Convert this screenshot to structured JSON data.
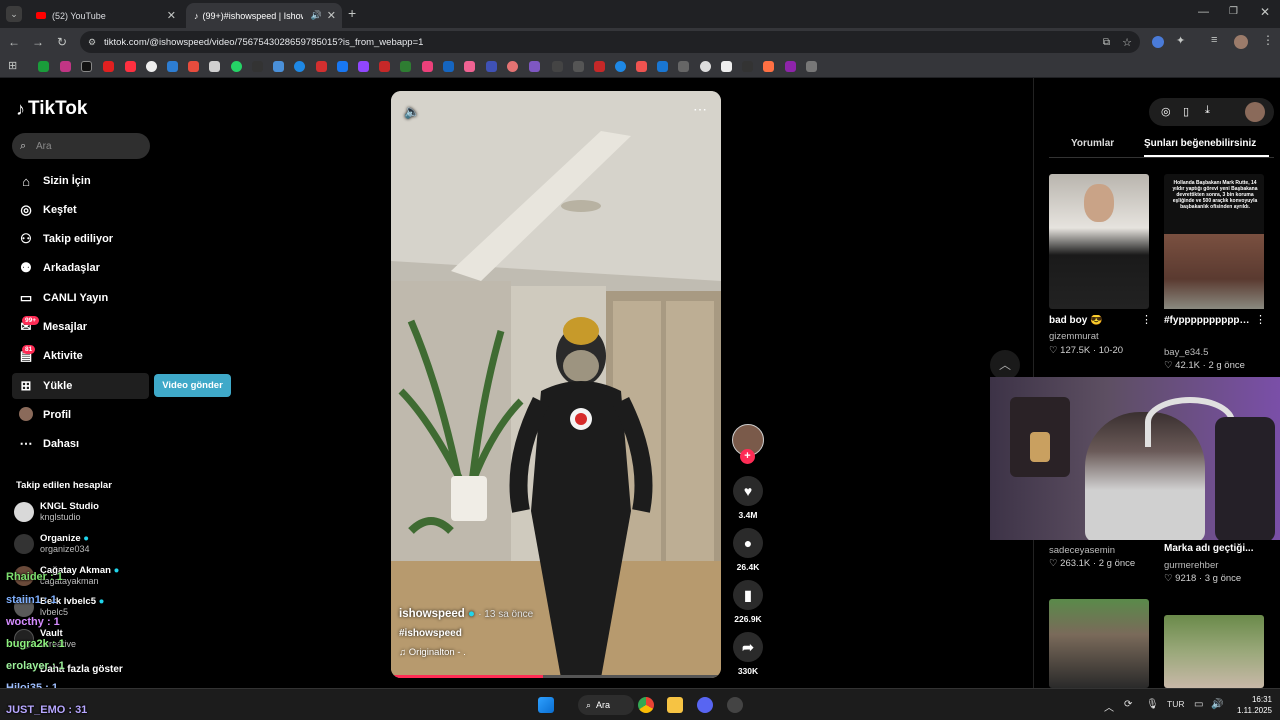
{
  "browser": {
    "tabs": [
      {
        "label": "(52) YouTube"
      },
      {
        "label": "(99+)#ishowspeed | Ishows"
      }
    ],
    "url": "tiktok.com/@ishowspeed/video/7567543028659785015?is_from_webapp=1"
  },
  "sidebar": {
    "logo": "TikTok",
    "search_placeholder": "Ara",
    "items": [
      {
        "label": "Sizin İçin"
      },
      {
        "label": "Keşfet"
      },
      {
        "label": "Takip ediliyor"
      },
      {
        "label": "Arkadaşlar"
      },
      {
        "label": "CANLI Yayın"
      },
      {
        "label": "Mesajlar",
        "badge": "99+"
      },
      {
        "label": "Aktivite",
        "badge": "81"
      },
      {
        "label": "Yükle"
      },
      {
        "label": "Profil"
      },
      {
        "label": "Dahası"
      }
    ],
    "upload_button": "Video gönder",
    "following_header": "Takip edilen hesaplar",
    "following": [
      {
        "name": "KNGL Studio",
        "user": "knglstudio"
      },
      {
        "name": "Organize",
        "user": "organize034"
      },
      {
        "name": "Çağatay Akman",
        "user": "cagatayakman"
      },
      {
        "name": "Berk Ivbelc5",
        "user": "lvbelc5"
      },
      {
        "name": "Vault",
        "user": "vcreative"
      }
    ],
    "show_more": "Daha fazla göster"
  },
  "chat_overlay": [
    {
      "text": "Rhaider : 1",
      "color": "#7ee06f"
    },
    {
      "text": "staiin1 : 1",
      "color": "#7fb0ff"
    },
    {
      "text": "wocthy : 1",
      "color": "#d58cff"
    },
    {
      "text": "bugra2k : 1",
      "color": "#8ef27f"
    },
    {
      "text": "erolayer : 1",
      "color": "#9cf09a"
    },
    {
      "text": "Hiloi35 : 1",
      "color": "#9fbfff"
    },
    {
      "text": "JUST_EMO : 31",
      "color": "#b7a7ff"
    }
  ],
  "video": {
    "author": "ishowspeed",
    "time": "· 13 sa önce",
    "hashtag": "#ishowspeed",
    "sound": "Originalton - ."
  },
  "actions": {
    "likes": "3.4M",
    "comments": "26.4K",
    "saves": "226.9K",
    "shares": "330K"
  },
  "right": {
    "tabs": [
      "Yorumlar",
      "Şunları beğenebilirsiniz"
    ],
    "cards": [
      {
        "title": "bad boy 😎",
        "user": "gizemmurat",
        "likes": "127.5K",
        "date": "10-20"
      },
      {
        "title": "#fypppppppppppppppppppppp...",
        "user": "bay_e34.5",
        "likes": "42.1K",
        "date": "2 g önce"
      },
      {
        "title": "",
        "user": "sadeceyasemin",
        "likes": "263.1K",
        "date": "2 g önce"
      },
      {
        "title": "Marka adı geçtiği...",
        "user": "gurmerehber",
        "likes": "9218",
        "date": "3 g önce"
      }
    ],
    "news_thumb_text": "Hollanda Başbakanı Mark Rutte, 14 yıldır yaptığı görevi yeni Başbakana devrettikten sonra, 3 bin koruma eşliğinde ve 500 araçlık konvoyuyla başbakanlık ofisinden ayrıldı."
  },
  "taskbar": {
    "search_label": "Ara",
    "lang": "TUR",
    "time": "16:31",
    "date": "1.11.2025"
  }
}
